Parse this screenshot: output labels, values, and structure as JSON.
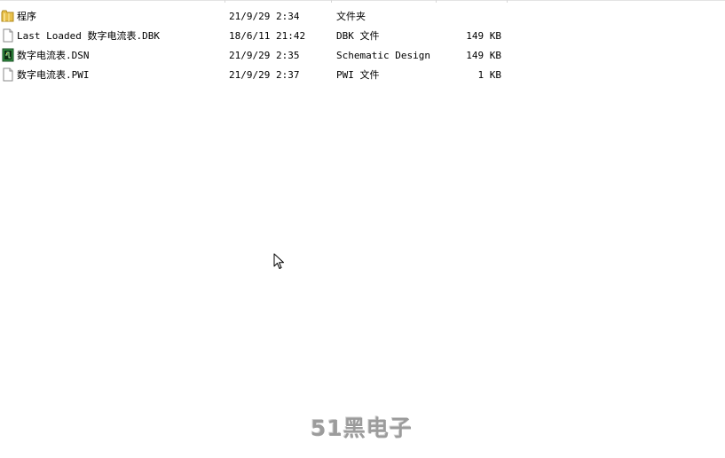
{
  "files": [
    {
      "name": "程序",
      "modified": "21/9/29 2:34",
      "type": "文件夹",
      "size": "",
      "icon": "folder-icon"
    },
    {
      "name": "Last Loaded 数字电流表.DBK",
      "modified": "18/6/11 21:42",
      "type": "DBK 文件",
      "size": "149 KB",
      "icon": "blank-file-icon"
    },
    {
      "name": "数字电流表.DSN",
      "modified": "21/9/29 2:35",
      "type": "Schematic Design",
      "size": "149 KB",
      "icon": "schematic-file-icon"
    },
    {
      "name": "数字电流表.PWI",
      "modified": "21/9/29 2:37",
      "type": "PWI 文件",
      "size": "1 KB",
      "icon": "blank-file-icon"
    }
  ],
  "watermark": {
    "text": "51黑电子"
  },
  "colors": {
    "folder": "#e8c04a",
    "schematic_icon": "#2e8b3e",
    "watermark": "#9c9c9c"
  }
}
